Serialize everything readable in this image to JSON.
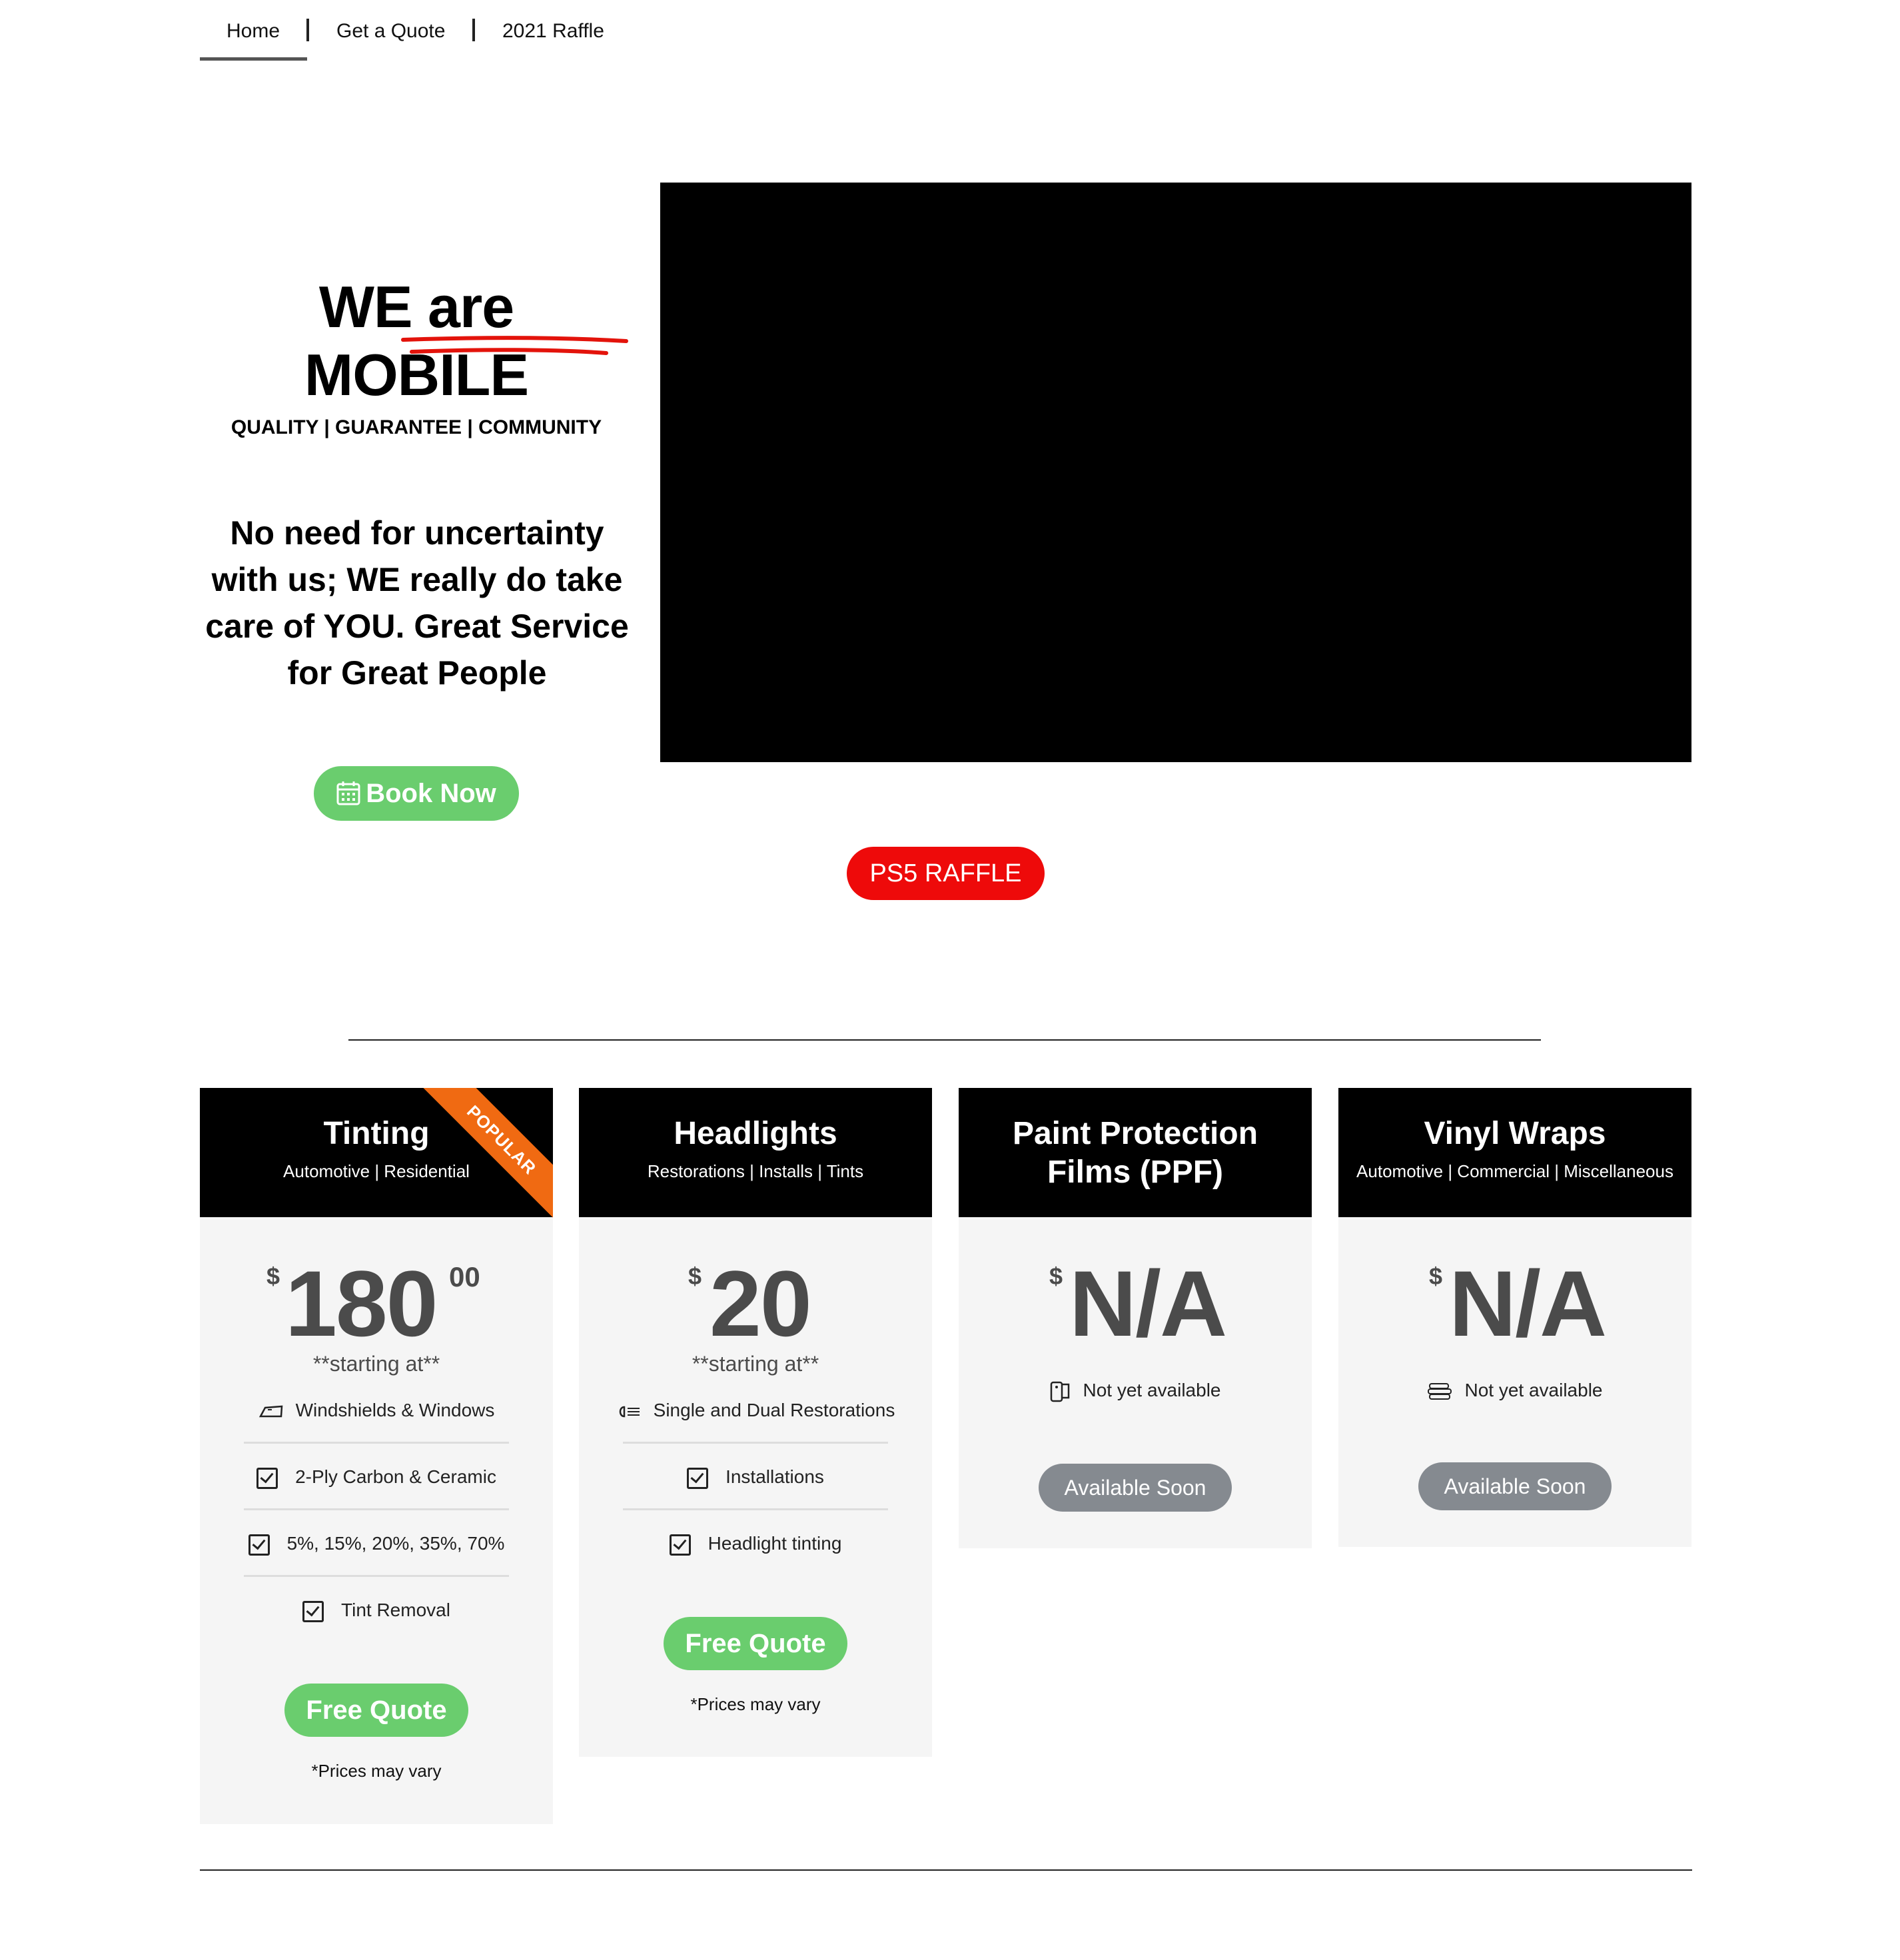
{
  "nav": {
    "items": [
      {
        "label": "Home"
      },
      {
        "label": "Get a Quote"
      },
      {
        "label": "2021 Raffle"
      }
    ]
  },
  "hero": {
    "title_prefix": "WE are ",
    "title_highlight": "MOBILE",
    "subtitle": "QUALITY | GUARANTEE | COMMUNITY",
    "text": "No need for uncertainty with us; WE really do take care of YOU. Great Service for Great People",
    "book_button": "Book Now",
    "raffle_button": "PS5 RAFFLE",
    "underline_color": "#e3130b"
  },
  "colors": {
    "green": "#6acd6e",
    "red": "#ee0a0a",
    "orange": "#f06a12",
    "gray_button": "#858a90"
  },
  "cards": [
    {
      "title": "Tinting",
      "tagline": "Automotive | Residential",
      "ribbon": "POPULAR",
      "currency": "$",
      "amount": "180",
      "cents": "00",
      "price_note": "**starting at**",
      "features": [
        "Windshields & Windows",
        "2-Ply Carbon & Ceramic",
        "5%, 15%, 20%, 35%, 70%",
        "Tint Removal"
      ],
      "button": "Free Quote",
      "footnote": "*Prices may vary"
    },
    {
      "title": "Headlights",
      "tagline": "Restorations | Installs | Tints",
      "currency": "$",
      "amount": "20",
      "price_note": "**starting at**",
      "features": [
        "Single and Dual Restorations",
        "Installations",
        "Headlight tinting"
      ],
      "button": "Free Quote",
      "footnote": "*Prices may vary"
    },
    {
      "title": "Paint Protection Films (PPF)",
      "currency": "$",
      "amount": "N/A",
      "feature": "Not yet available",
      "button": "Available Soon"
    },
    {
      "title": "Vinyl Wraps",
      "tagline": "Automotive | Commercial | Miscellaneous",
      "currency": "$",
      "amount": "N/A",
      "feature": "Not yet available",
      "button": "Available Soon"
    }
  ]
}
